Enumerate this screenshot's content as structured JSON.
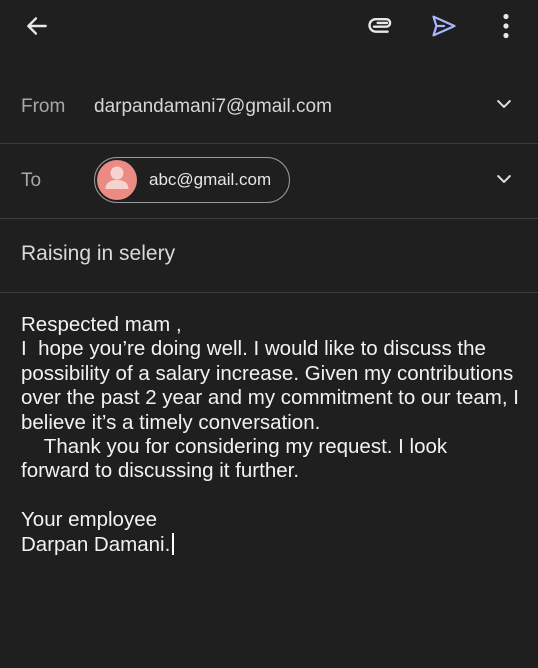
{
  "toolbar": {
    "back_icon": "arrow-left-icon",
    "attach_icon": "paperclip-icon",
    "send_icon": "send-icon",
    "more_icon": "more-vert-icon",
    "send_color": "#a8b5ff"
  },
  "from": {
    "label": "From",
    "value": "darpandamani7@gmail.com"
  },
  "to": {
    "label": "To",
    "recipient": "abc@gmail.com",
    "avatar_color": "#ec8a84"
  },
  "subject": "Raising in selery",
  "body": "Respected mam ,\nI  hope you’re doing well. I would like to discuss the possibility of a salary increase. Given my contributions over the past 2 year and my commitment to our team, I believe it’s a timely conversation.\n    Thank you for considering my request. I look forward to discussing it further.\n\nYour employee\nDarpan Damani."
}
